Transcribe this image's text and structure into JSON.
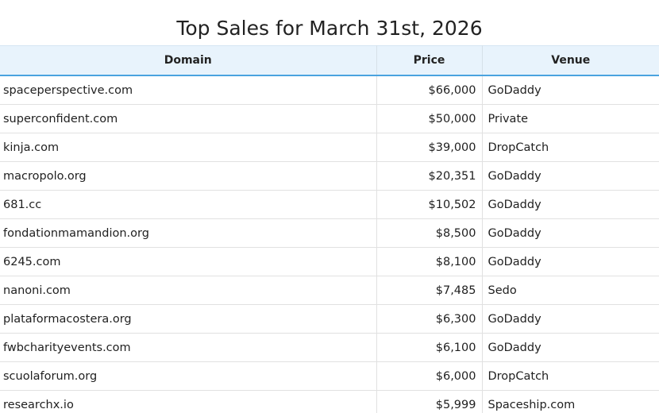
{
  "page": {
    "title": "Top Sales for March 31st, 2026"
  },
  "table": {
    "columns": {
      "domain": "Domain",
      "price": "Price",
      "venue": "Venue"
    },
    "rows": [
      {
        "domain": "spaceperspective.com",
        "price": "$66,000",
        "venue": "GoDaddy"
      },
      {
        "domain": "superconfident.com",
        "price": "$50,000",
        "venue": "Private"
      },
      {
        "domain": "kinja.com",
        "price": "$39,000",
        "venue": "DropCatch"
      },
      {
        "domain": "macropolo.org",
        "price": "$20,351",
        "venue": "GoDaddy"
      },
      {
        "domain": "681.cc",
        "price": "$10,502",
        "venue": "GoDaddy"
      },
      {
        "domain": "fondationmamandion.org",
        "price": "$8,500",
        "venue": "GoDaddy"
      },
      {
        "domain": "6245.com",
        "price": "$8,100",
        "venue": "GoDaddy"
      },
      {
        "domain": "nanoni.com",
        "price": "$7,485",
        "venue": "Sedo"
      },
      {
        "domain": "plataformacostera.org",
        "price": "$6,300",
        "venue": "GoDaddy"
      },
      {
        "domain": "fwbcharityevents.com",
        "price": "$6,100",
        "venue": "GoDaddy"
      },
      {
        "domain": "scuolaforum.org",
        "price": "$6,000",
        "venue": "DropCatch"
      },
      {
        "domain": "researchx.io",
        "price": "$5,999",
        "venue": "Spaceship.com"
      }
    ]
  },
  "colors": {
    "header_bg": "#e8f3fc",
    "header_accent": "#4aa3df",
    "row_border": "#e1e1e1"
  }
}
